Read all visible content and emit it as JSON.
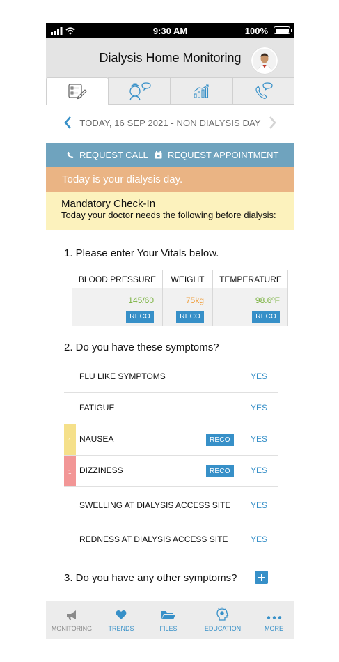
{
  "status_bar": {
    "time": "9:30 AM",
    "battery": "100%"
  },
  "header": {
    "title": "Dialysis Home Monitoring"
  },
  "tabs": [
    "checklist-icon",
    "nurse-chat-icon",
    "chart-icon",
    "phone-chat-icon"
  ],
  "date_bar": {
    "label": "TODAY, 16 SEP 2021 - NON DIALYSIS DAY"
  },
  "actions": {
    "request_call": "REQUEST CALL",
    "request_appointment": "REQUEST APPOINTMENT"
  },
  "banner": {
    "dialysis_day": "Today is your dialysis day."
  },
  "checkin": {
    "title": "Mandatory Check-In",
    "subtitle": "Today your doctor needs the following before dialysis:"
  },
  "vitals_section": {
    "heading": "1. Please enter Your Vitals below.",
    "columns": [
      {
        "label": "BLOOD PRESSURE",
        "value": "145/60",
        "color": "#7cb342",
        "reco": "RECO"
      },
      {
        "label": "WEIGHT",
        "value": "75kg",
        "color": "#f0a040",
        "reco": "RECO"
      },
      {
        "label": "TEMPERATURE",
        "value": "98.6ºF",
        "color": "#7cb342",
        "reco": "RECO"
      }
    ]
  },
  "symptoms_section": {
    "heading": "2. Do you have these symptoms?",
    "items": [
      {
        "name": "FLU LIKE SYMPTOMS",
        "answer": "YES"
      },
      {
        "name": "FATIGUE",
        "answer": "YES"
      },
      {
        "name": "NAUSEA",
        "answer": "YES",
        "reco": "RECO",
        "marker": "1",
        "marker_color": "#f5e08a"
      },
      {
        "name": "DIZZINESS",
        "answer": "YES",
        "reco": "RECO",
        "marker": "1",
        "marker_color": "#f29696"
      },
      {
        "name": "SWELLING AT DIALYSIS ACCESS SITE",
        "answer": "YES"
      },
      {
        "name": "REDNESS AT DIALYSIS ACCESS SITE",
        "answer": "YES"
      }
    ]
  },
  "other_section": {
    "heading": "3. Do you have any other symptoms?"
  },
  "nav": [
    {
      "label": "MONITORING",
      "icon": "megaphone-icon",
      "color": "#8a8a8a"
    },
    {
      "label": "TRENDS",
      "icon": "heart-icon",
      "color": "#3790c8"
    },
    {
      "label": "FILES",
      "icon": "folder-icon",
      "color": "#3790c8"
    },
    {
      "label": "EDUCATION",
      "icon": "head-idea-icon",
      "color": "#3790c8"
    },
    {
      "label": "MORE",
      "icon": "more-dots-icon",
      "color": "#3790c8"
    }
  ],
  "colors": {
    "accent": "#3790c8",
    "action_bar": "#6fa3be",
    "banner": "#eab484",
    "checkin_bg": "#fcf2bd"
  }
}
